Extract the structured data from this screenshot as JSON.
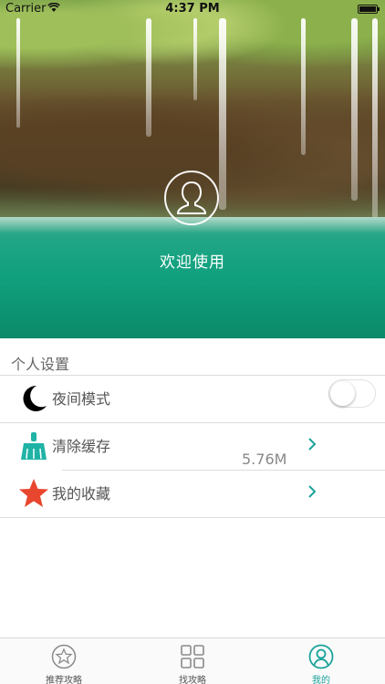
{
  "status_bar": {
    "carrier": "Carrier",
    "time": "4:37 PM"
  },
  "header": {
    "welcome_text": "欢迎使用"
  },
  "settings": {
    "section_title": "个人设置",
    "items": [
      {
        "label": "夜间模式",
        "icon": "moon-icon",
        "control": "toggle",
        "toggle_on": false
      },
      {
        "label": "清除缓存",
        "icon": "broom-icon",
        "control": "chevron",
        "detail": "5.76M"
      },
      {
        "label": "我的收藏",
        "icon": "star-icon",
        "control": "chevron"
      }
    ]
  },
  "tabbar": {
    "tabs": [
      {
        "label": "推荐攻略",
        "icon": "star-circle-icon",
        "active": false
      },
      {
        "label": "找攻略",
        "icon": "grid-icon",
        "active": false
      },
      {
        "label": "我的",
        "icon": "user-circle-icon",
        "active": true
      }
    ]
  },
  "colors": {
    "accent": "#1aa39a",
    "moon": "#000000",
    "broom": "#1fb3a5",
    "star": "#e8462e",
    "inactive_tab": "#8a8a8a"
  }
}
